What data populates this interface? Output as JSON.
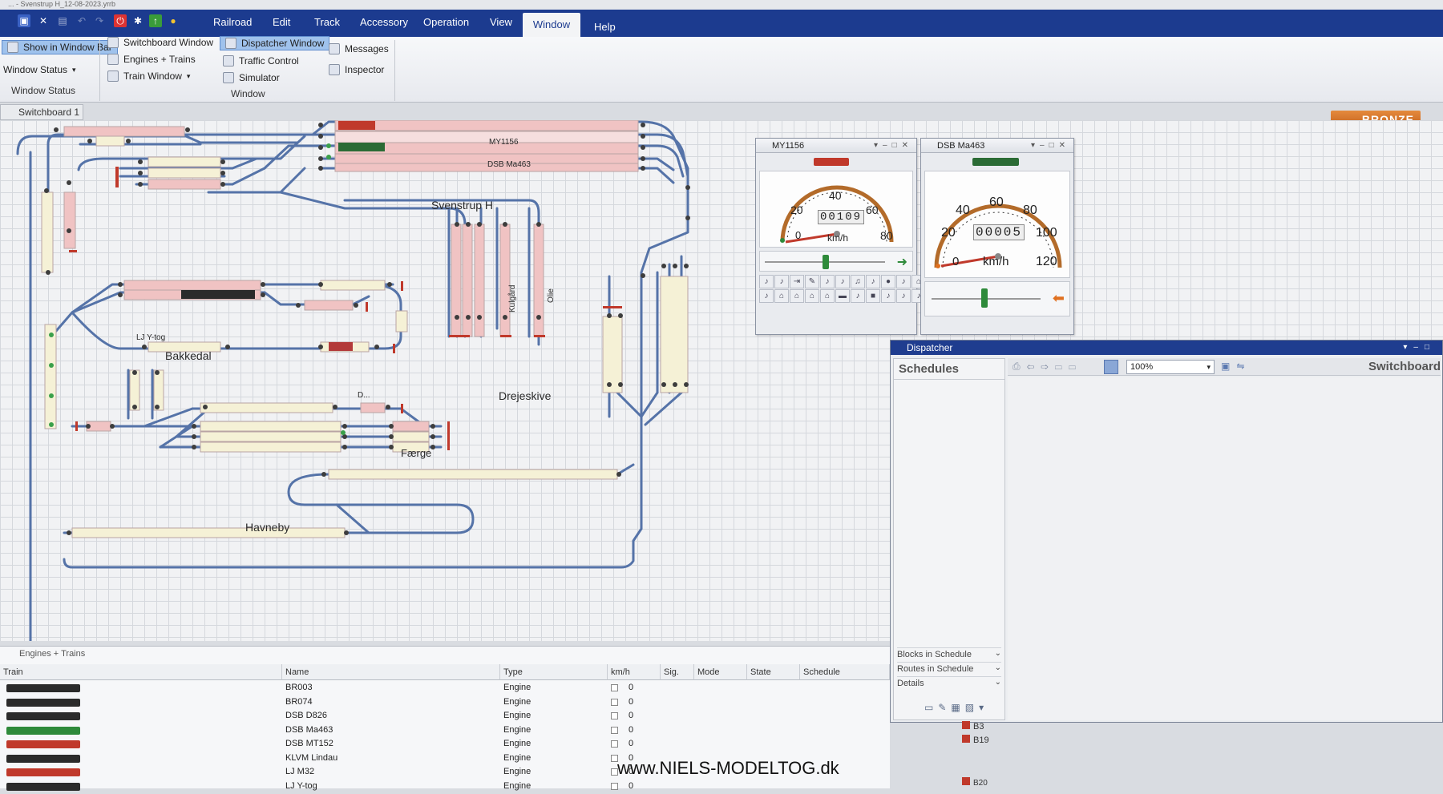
{
  "window": {
    "title": "... - Svenstrup H_12-08-2023.yrrb"
  },
  "menu": [
    "Railroad",
    "Edit",
    "Track",
    "Accessory",
    "Operation",
    "View",
    "Window",
    "Help"
  ],
  "ribbon": {
    "show_in_window_bar": "Show in Window Bar",
    "window_status_dropdown": "Window Status",
    "group_window_status": "Window Status",
    "switchboard_window": "Switchboard Window",
    "dispatcher_window": "Dispatcher Window",
    "engines_trains": "Engines + Trains",
    "traffic_control": "Traffic Control",
    "train_window": "Train Window",
    "simulator": "Simulator",
    "messages": "Messages",
    "inspector": "Inspector",
    "group_window": "Window"
  },
  "switchboard": {
    "tab": "Switchboard 1",
    "edition": "Bronze",
    "labels": {
      "svenstrup": "Svenstrup H",
      "bakkedal": "Bakkedal",
      "drejeskive": "Drejeskive",
      "faerge": "Færge",
      "havneby": "Havneby",
      "kulgard": "Kulgård",
      "olie": "Olie",
      "lj_ytog": "LJ Y-tog",
      "my1156_block": "MY1156",
      "dsb_block": "DSB Ma463",
      "d_block": "D..."
    }
  },
  "loco1": {
    "name": "MY1156",
    "odometer": "00109",
    "unit": "km/h",
    "ticks": [
      "20",
      "40",
      "60",
      "80",
      "0"
    ],
    "speed": 0
  },
  "loco2": {
    "name": "DSB Ma463",
    "odometer": "00005",
    "unit": "km/h",
    "ticks": [
      "20",
      "40",
      "60",
      "80",
      "100",
      "120",
      "0"
    ],
    "speed": 0
  },
  "dispatcher": {
    "title": "Dispatcher",
    "schedules": "Schedules",
    "zoom": "100%",
    "switchboard": "Switchboard",
    "blocks_in_schedule": "Blocks in Schedule",
    "routes_in_schedule": "Routes in Schedule",
    "details": "Details",
    "bottom_items": [
      "B3",
      "B19",
      "B20"
    ]
  },
  "engines": {
    "tab": "Engines + Trains",
    "columns": [
      "Train",
      "Name",
      "Type",
      "km/h",
      "Sig.",
      "Mode",
      "State",
      "Schedule"
    ],
    "rows": [
      {
        "name": "BR003",
        "type": "Engine",
        "speed": "0",
        "color": "#2b2b2b"
      },
      {
        "name": "BR074",
        "type": "Engine",
        "speed": "0",
        "color": "#2b2b2b"
      },
      {
        "name": "DSB D826",
        "type": "Engine",
        "speed": "0",
        "color": "#2b2b2b"
      },
      {
        "name": "DSB Ma463",
        "type": "Engine",
        "speed": "0",
        "color": "#2e8a3a"
      },
      {
        "name": "DSB MT152",
        "type": "Engine",
        "speed": "0",
        "color": "#c0392b"
      },
      {
        "name": "KLVM Lindau",
        "type": "Engine",
        "speed": "0",
        "color": "#2b2b2b"
      },
      {
        "name": "LJ M32",
        "type": "Engine",
        "speed": "0",
        "color": "#c0392b"
      },
      {
        "name": "LJ Y-tog",
        "type": "Engine",
        "speed": "0",
        "color": "#2b2b2b"
      }
    ]
  },
  "watermark": "www.NIELS-MODELTOG.dk"
}
